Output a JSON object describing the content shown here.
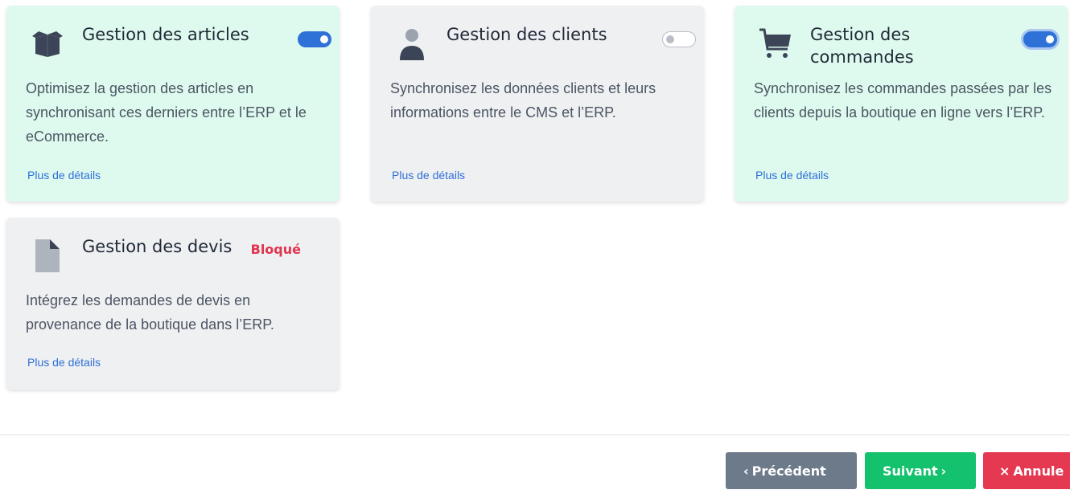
{
  "modules": [
    {
      "title": "Gestion des articles",
      "description": "Optimisez la gestion des articles en synchronisant ces derniers entre l’ERP et le eCommerce.",
      "link": "Plus de détails",
      "icon": "box-icon",
      "enabled": true
    },
    {
      "title": "Gestion des clients",
      "description": "Synchronisez les données clients et leurs informations entre le CMS et l’ERP.",
      "link": "Plus de détails",
      "icon": "user-icon",
      "enabled": false
    },
    {
      "title": "Gestion des commandes",
      "description": "Synchronisez les commandes passées par les clients depuis la boutique en ligne vers l’ERP.",
      "link": "Plus de détails",
      "icon": "cart-icon",
      "enabled": true
    },
    {
      "title": "Gestion des devis",
      "description": "Intégrez les demandes de devis en provenance de la boutique dans l’ERP.",
      "link": "Plus de détails",
      "icon": "document-icon",
      "status": "Bloqué"
    }
  ],
  "footer": {
    "prev_glyph": "‹",
    "prev_label": "Précédent",
    "next_label": "Suivant",
    "next_glyph": "›",
    "cancel_glyph": "×",
    "cancel_label": "Annule"
  },
  "colors": {
    "card_enabled_bg": "#defaee",
    "card_disabled_bg": "#eff0f2",
    "toggle_on": "#2e72d8",
    "link": "#2f6fd8",
    "blocked": "#e0344f",
    "btn_prev": "#6c7a89",
    "btn_next": "#14c16d",
    "btn_cancel": "#e53851"
  }
}
